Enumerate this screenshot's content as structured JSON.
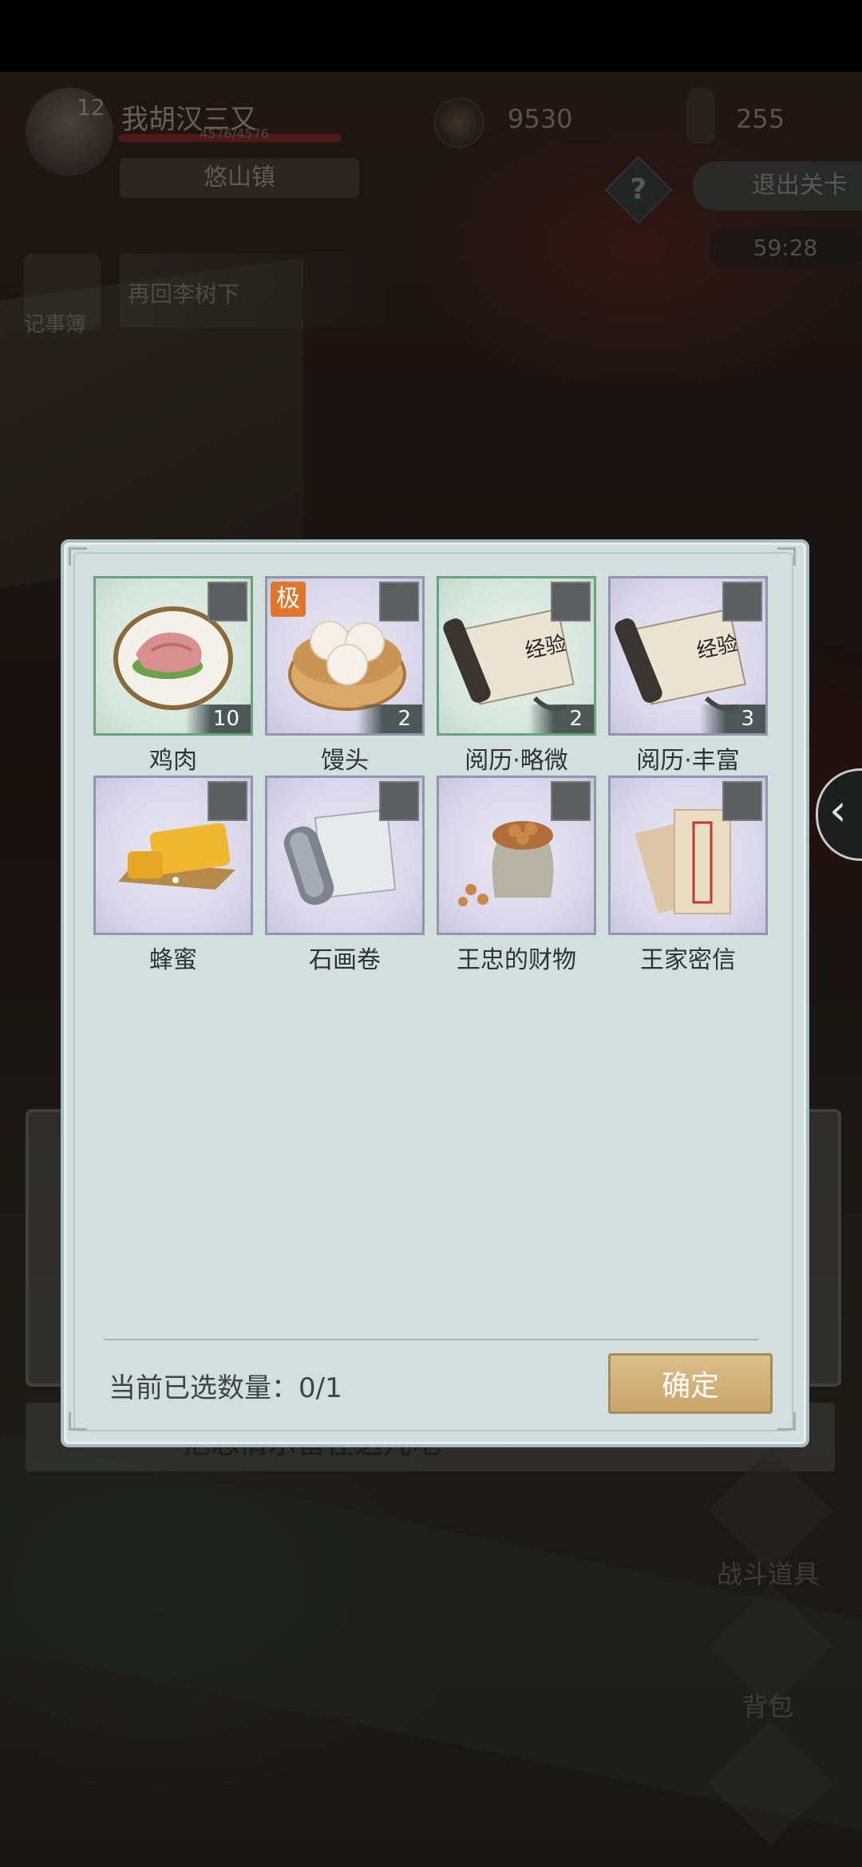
{
  "hud": {
    "level": "12",
    "player_name": "我胡汉三又",
    "hp_text": "4576/4576",
    "hp_fraction": 1.0,
    "location": "悠山镇",
    "coins": "9530",
    "tokens": "255",
    "help_glyph": "?",
    "exit_label": "退出关卡",
    "timer": "59:28",
    "journal_label": "记事簿",
    "quest_text": "再回李树下"
  },
  "background": {
    "dialog_text": "把忠情示留在这儿吧",
    "right_buttons": [
      {
        "label": "战斗道具",
        "icon": "battle-items-icon"
      },
      {
        "label": "背包",
        "icon": "bag-icon"
      }
    ],
    "side_tab_glyph": "‹"
  },
  "modal": {
    "items": [
      {
        "name": "鸡肉",
        "count": "10",
        "frame": "green",
        "icon": "chicken-meat-icon"
      },
      {
        "name": "馒头",
        "count": "2",
        "frame": "purple",
        "tag": "极",
        "icon": "steamed-bun-icon"
      },
      {
        "name": "阅历·略微",
        "count": "2",
        "frame": "green",
        "icon": "experience-scroll-icon"
      },
      {
        "name": "阅历·丰富",
        "count": "3",
        "frame": "purple",
        "icon": "experience-scroll-icon"
      },
      {
        "name": "蜂蜜",
        "count": "",
        "frame": "purple",
        "icon": "honey-icon"
      },
      {
        "name": "石画卷",
        "count": "",
        "frame": "purple",
        "icon": "stone-scroll-icon"
      },
      {
        "name": "王忠的财物",
        "count": "",
        "frame": "purple",
        "icon": "coin-sack-icon"
      },
      {
        "name": "王家密信",
        "count": "",
        "frame": "purple",
        "icon": "letter-icon"
      }
    ],
    "scroll_text": "经验",
    "selected_label": "当前已选数量：",
    "selected_value": "0/1",
    "confirm_label": "确定"
  },
  "colors": {
    "modal_bg": "#d3dede",
    "green_frame": "#6aa27b",
    "purple_frame": "#8f97ad",
    "confirm_gold": "#c9a46a",
    "tag_orange": "#e0752e"
  }
}
